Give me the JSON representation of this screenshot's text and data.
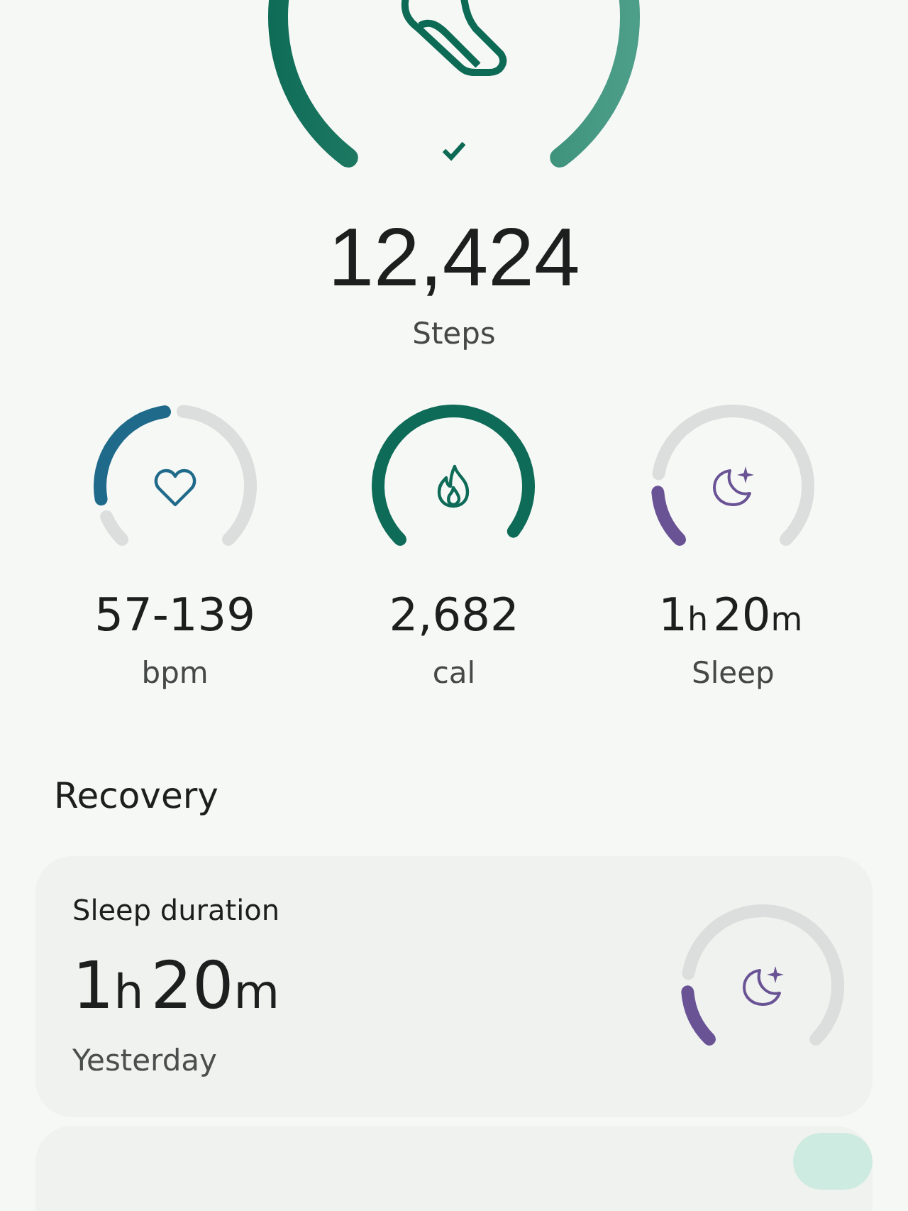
{
  "steps": {
    "completed": true,
    "value": "12,424",
    "label": "Steps"
  },
  "metrics": [
    {
      "kind": "heart",
      "value": [
        {
          "num": "57-139"
        }
      ],
      "label": "bpm",
      "color": "#1f6a8a"
    },
    {
      "kind": "fire",
      "value": [
        {
          "num": "2,682"
        }
      ],
      "label": "cal",
      "color": "#0e6b57"
    },
    {
      "kind": "moon",
      "value": [
        {
          "num": "1",
          "unit": "h"
        },
        {
          "num": "20",
          "unit": "m"
        }
      ],
      "label": "Sleep",
      "color": "#6a5395"
    }
  ],
  "section_title": "Recovery",
  "cards": [
    {
      "title": "Sleep duration",
      "value": [
        {
          "num": "1",
          "unit": "h"
        },
        {
          "num": "20",
          "unit": "m"
        }
      ],
      "subtitle": "Yesterday",
      "kind": "moon",
      "color": "#6a5395"
    }
  ]
}
